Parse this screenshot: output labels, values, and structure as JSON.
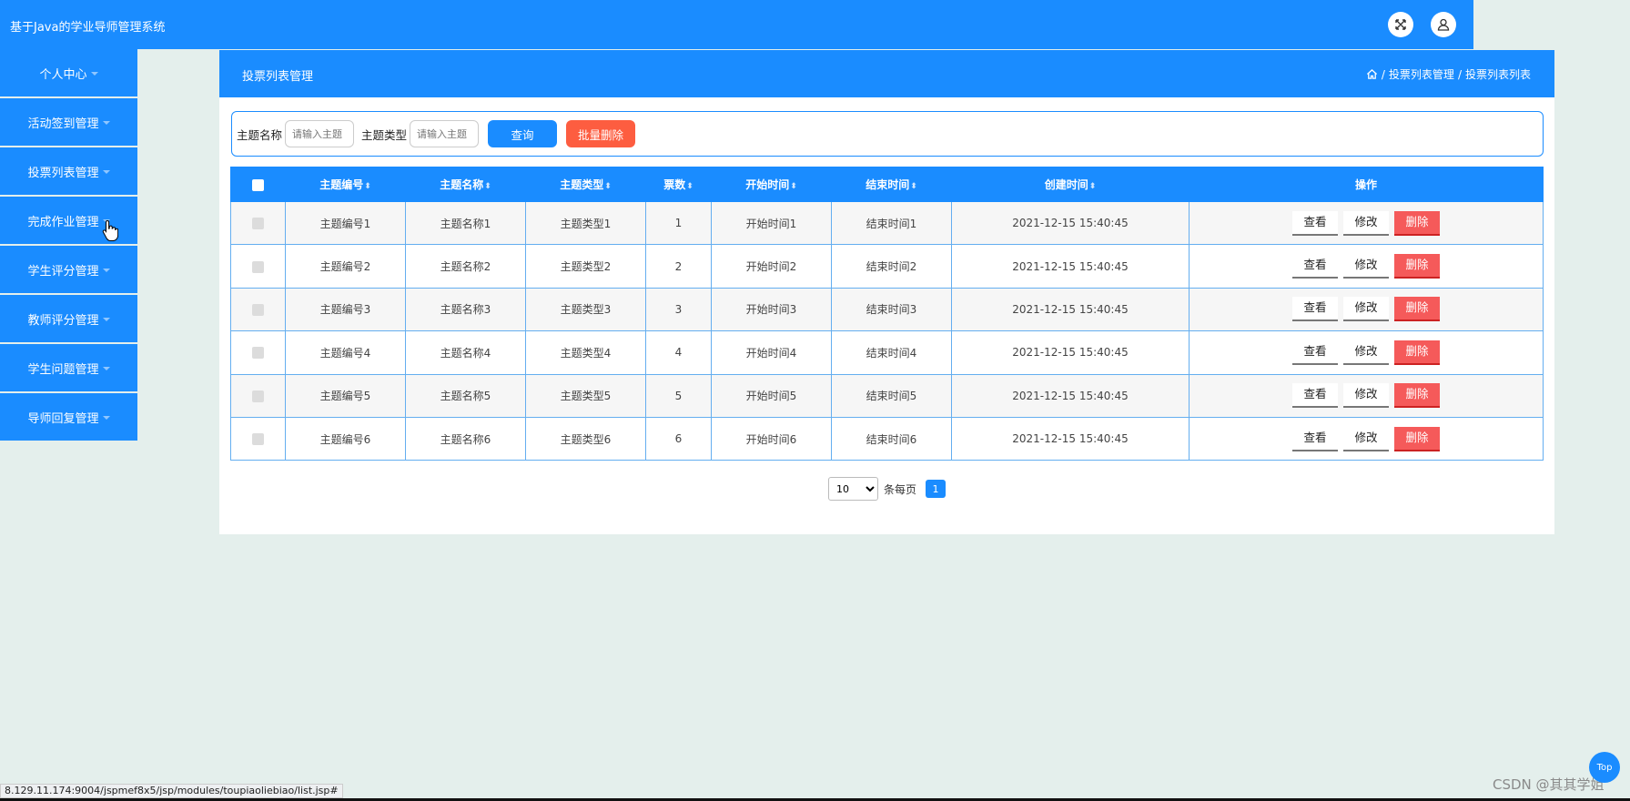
{
  "header": {
    "app_title": "基于Java的学业导师管理系统"
  },
  "sidebar": {
    "items": [
      {
        "label": "个人中心"
      },
      {
        "label": "活动签到管理"
      },
      {
        "label": "投票列表管理"
      },
      {
        "label": "完成作业管理"
      },
      {
        "label": "学生评分管理"
      },
      {
        "label": "教师评分管理"
      },
      {
        "label": "学生问题管理"
      },
      {
        "label": "导师回复管理"
      }
    ]
  },
  "main": {
    "title": "投票列表管理",
    "breadcrumb": [
      "投票列表管理",
      "投票列表列表"
    ],
    "breadcrumb_sep": "/"
  },
  "search": {
    "name_label": "主题名称",
    "name_placeholder": "请输入主题",
    "type_label": "主题类型",
    "type_placeholder": "请输入主题",
    "query_label": "查询",
    "batch_delete_label": "批量删除"
  },
  "table": {
    "columns": [
      "主题编号",
      "主题名称",
      "主题类型",
      "票数",
      "开始时间",
      "结束时间",
      "创建时间",
      "操作"
    ],
    "rows": [
      {
        "code": "主题编号1",
        "name": "主题名称1",
        "type": "主题类型1",
        "votes": "1",
        "start": "开始时间1",
        "end": "结束时间1",
        "created": "2021-12-15 15:40:45"
      },
      {
        "code": "主题编号2",
        "name": "主题名称2",
        "type": "主题类型2",
        "votes": "2",
        "start": "开始时间2",
        "end": "结束时间2",
        "created": "2021-12-15 15:40:45"
      },
      {
        "code": "主题编号3",
        "name": "主题名称3",
        "type": "主题类型3",
        "votes": "3",
        "start": "开始时间3",
        "end": "结束时间3",
        "created": "2021-12-15 15:40:45"
      },
      {
        "code": "主题编号4",
        "name": "主题名称4",
        "type": "主题类型4",
        "votes": "4",
        "start": "开始时间4",
        "end": "结束时间4",
        "created": "2021-12-15 15:40:45"
      },
      {
        "code": "主题编号5",
        "name": "主题名称5",
        "type": "主题类型5",
        "votes": "5",
        "start": "开始时间5",
        "end": "结束时间5",
        "created": "2021-12-15 15:40:45"
      },
      {
        "code": "主题编号6",
        "name": "主题名称6",
        "type": "主题类型6",
        "votes": "6",
        "start": "开始时间6",
        "end": "结束时间6",
        "created": "2021-12-15 15:40:45"
      }
    ],
    "actions": {
      "view": "查看",
      "edit": "修改",
      "delete": "删除"
    }
  },
  "pagination": {
    "page_size": "10",
    "per_page_label": "条每页",
    "current_page": "1"
  },
  "status_url": "8.129.11.174:9004/jspmef8x5/jsp/modules/toupiaoliebiao/list.jsp#",
  "back_to_top": "Top",
  "watermark": "CSDN @其其学姐",
  "colors": {
    "primary": "#1a8cff",
    "danger": "#f55a5a",
    "batch": "#fd5d40",
    "background": "#e4efec"
  }
}
